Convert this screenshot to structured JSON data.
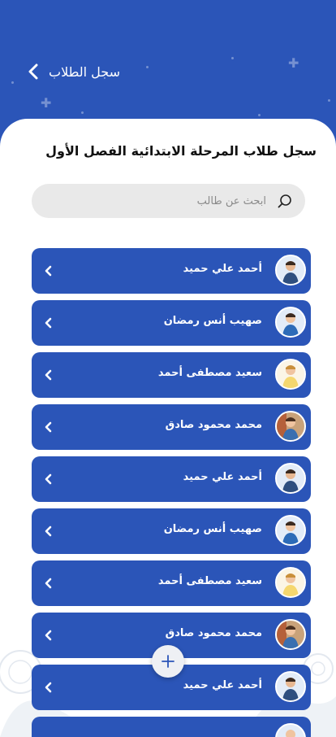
{
  "header": {
    "title": "سجل الطلاب"
  },
  "page": {
    "title": "سجل طلاب المرحلة الابتدائية الفصل الأول"
  },
  "search": {
    "placeholder": "ابحث عن طالب"
  },
  "students": [
    {
      "name": "أحمد علي حميد"
    },
    {
      "name": "صهيب أنس رمضان"
    },
    {
      "name": "سعيد مصطفى أحمد"
    },
    {
      "name": "محمد محمود صادق"
    },
    {
      "name": "أحمد علي حميد"
    },
    {
      "name": "صهيب أنس رمضان"
    },
    {
      "name": "سعيد مصطفى أحمد"
    },
    {
      "name": "محمد محمود صادق"
    },
    {
      "name": "أحمد علي حميد"
    },
    {
      "name": ""
    }
  ],
  "colors": {
    "primary": "#2b55b8",
    "surface": "#ffffff",
    "search_bg": "#e9e9e9"
  },
  "icons": {
    "back": "chevron-left-icon",
    "search": "search-icon",
    "row": "chevron-left-icon",
    "fab": "plus-icon"
  }
}
